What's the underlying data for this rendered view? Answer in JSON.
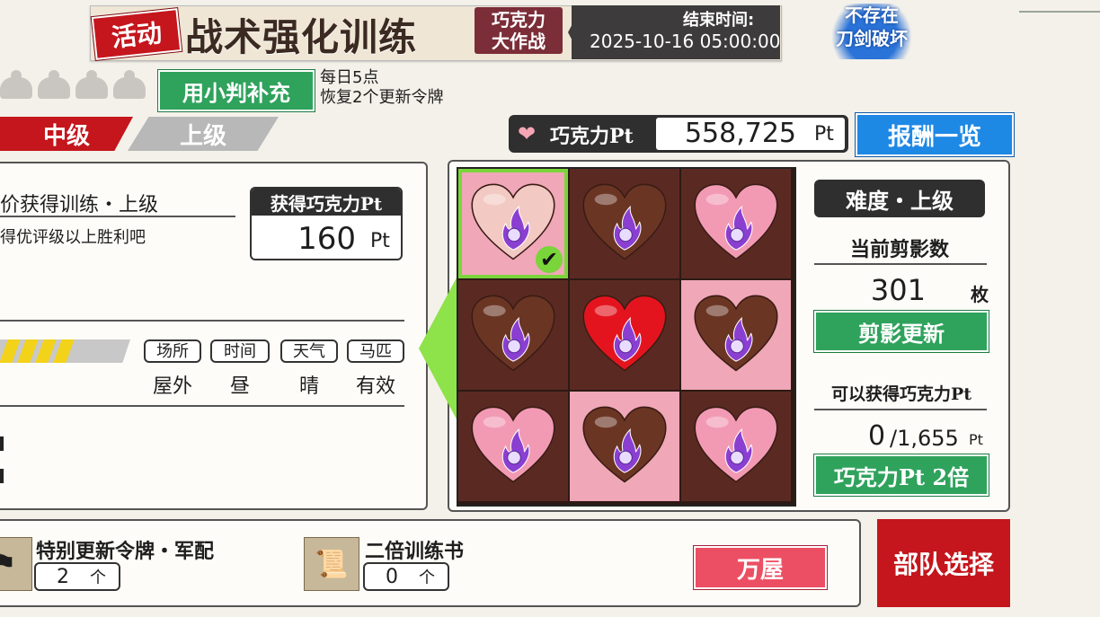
{
  "event": {
    "tag": "活动",
    "title": "战术强化训练",
    "subtitle_line1": "巧克力",
    "subtitle_line2": "大作战",
    "end_label": "结束时间:",
    "end_time": "2025-10-16 05:00:00"
  },
  "no_broken_badge": {
    "line1": "不存在",
    "line2": "刀剑破坏"
  },
  "refill": {
    "button_label": "用小判补充",
    "note_line1": "每日5点",
    "note_line2": "恢复2个更新令牌"
  },
  "grade_tabs": {
    "mid": "中级",
    "upper": "上级"
  },
  "choco": {
    "label": "巧克力Pt",
    "value": "558,725",
    "unit": "Pt"
  },
  "reward_button": "报酬一览",
  "mission": {
    "title": "价获得训练・上级",
    "desc": "得优评级以上胜利吧",
    "earn_header": "获得巧克力Pt",
    "earn_value": "160",
    "earn_unit": "Pt"
  },
  "conditions": [
    {
      "tag": "场所",
      "value": "屋外"
    },
    {
      "tag": "时间",
      "value": "昼"
    },
    {
      "tag": "天气",
      "value": "晴"
    },
    {
      "tag": "马匹",
      "value": "有效"
    }
  ],
  "grid": {
    "cells": [
      {
        "heart": "pale",
        "selected": true
      },
      {
        "heart": "brown",
        "selected": false
      },
      {
        "heart": "pink",
        "selected": false
      },
      {
        "heart": "brown",
        "selected": false
      },
      {
        "heart": "red",
        "selected": false
      },
      {
        "heart": "brown",
        "selected": false
      },
      {
        "heart": "pink",
        "selected": false
      },
      {
        "heart": "brown",
        "selected": false
      },
      {
        "heart": "pink",
        "selected": false
      }
    ],
    "check_icon": "✔"
  },
  "info": {
    "difficulty": "难度・上级",
    "silhouette_label": "当前剪影数",
    "silhouette_count": "301",
    "silhouette_unit": "枚",
    "silhouette_button": "剪影更新",
    "obtainable_label": "可以获得巧克力Pt",
    "obtainable_current": "0",
    "obtainable_max": "/1,655",
    "obtainable_unit": "Pt",
    "double_button": "巧克力Pt 2倍"
  },
  "items": [
    {
      "name": "特别更新令牌・军配",
      "count": "2",
      "unit": "个",
      "icon": "token-icon"
    },
    {
      "name": "二倍训练书",
      "count": "0",
      "unit": "个",
      "icon": "scroll-icon"
    }
  ],
  "shop_button": "万屋",
  "team_button": "部队选择",
  "colors": {
    "accent_red": "#c4161c",
    "accent_green": "#2fa25c",
    "accent_blue": "#1e88e5",
    "selection_green": "#7ad53a"
  }
}
